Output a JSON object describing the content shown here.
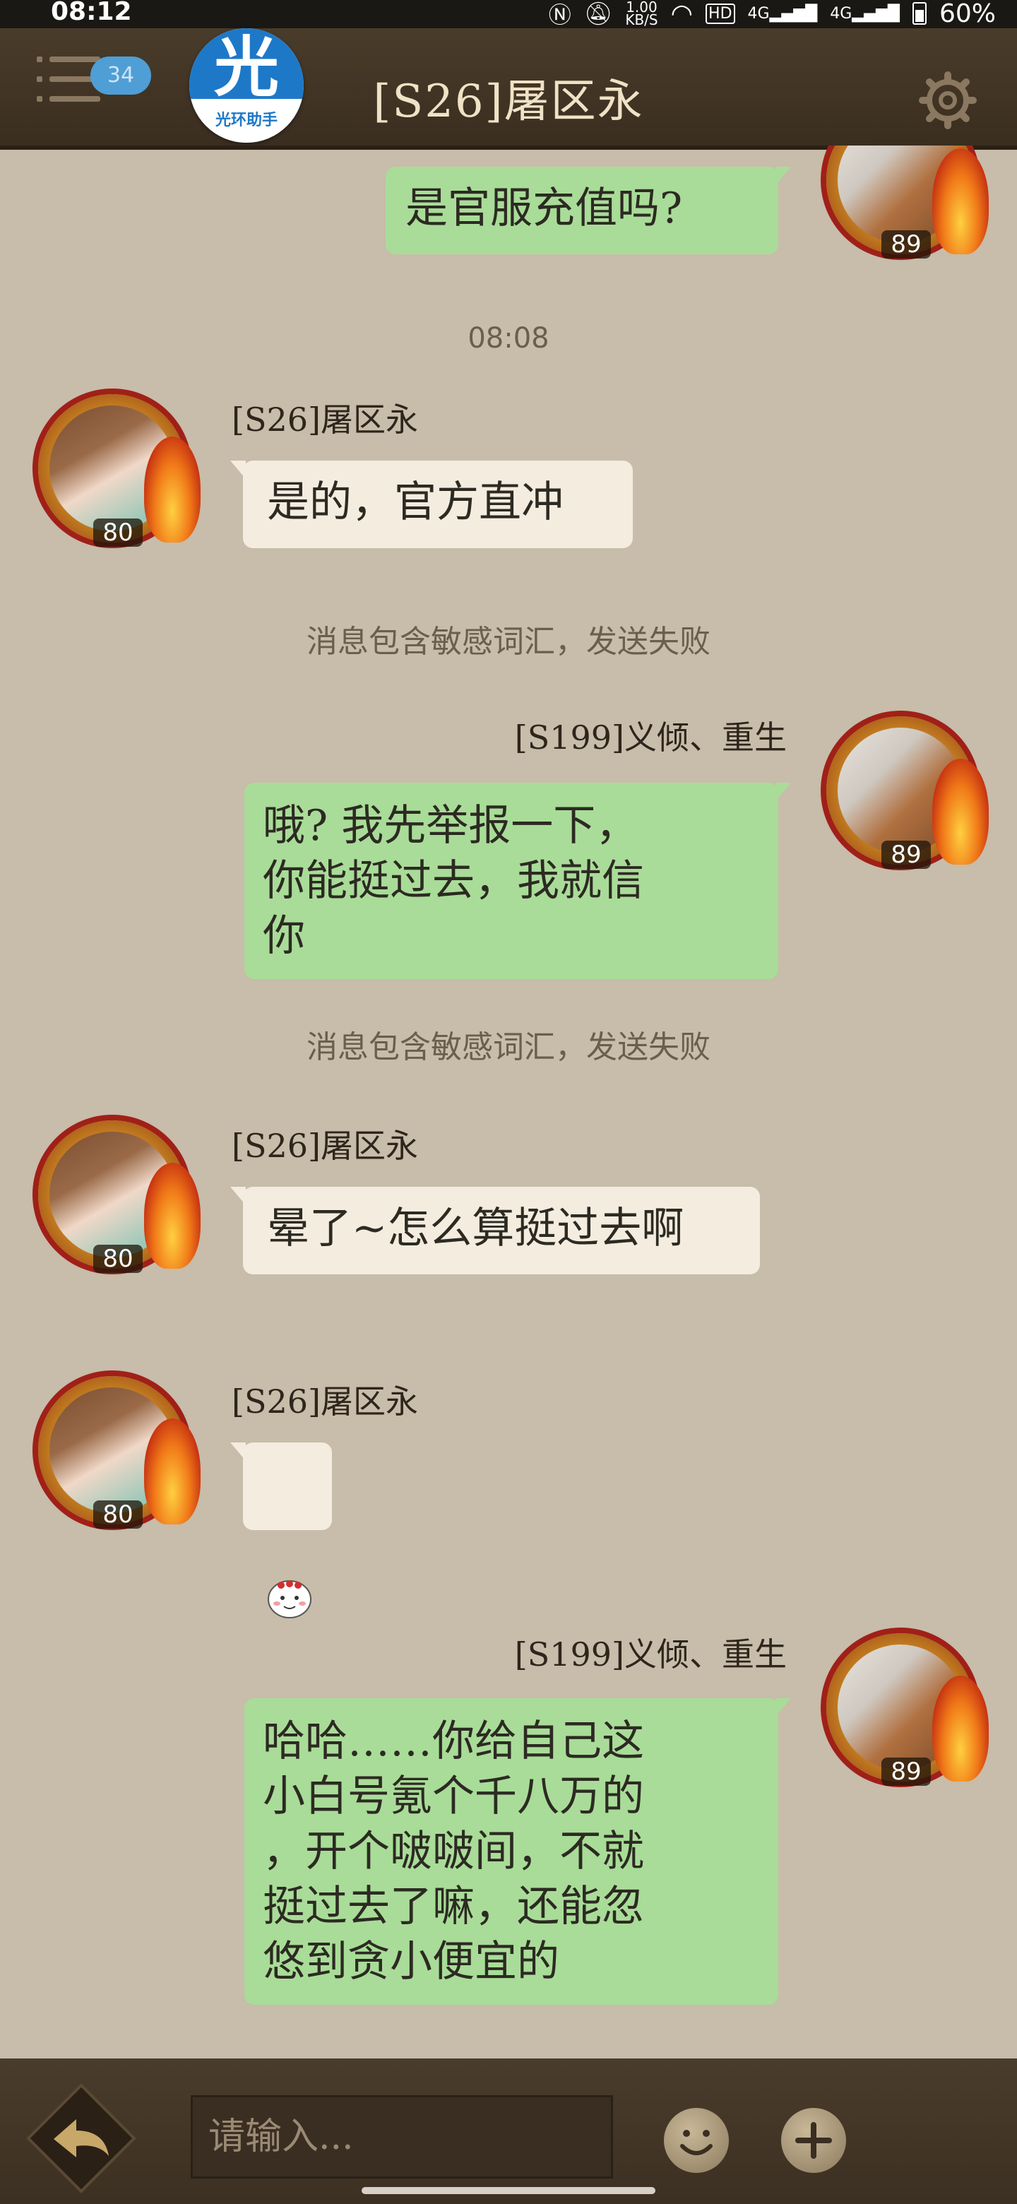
{
  "status_bar": {
    "time": "08:12",
    "net_speed_value": "1.00",
    "net_speed_unit": "KB/S",
    "hd_label": "HD",
    "signal_label_1": "4G",
    "signal_label_2": "4G",
    "battery": "60%"
  },
  "header": {
    "badge_count": "34",
    "logo_glyph": "光",
    "logo_text": "光环助手",
    "title": "[S26]屠区永"
  },
  "messages": [
    {
      "side": "right",
      "text": "是官服充值吗?",
      "level": "89"
    },
    {
      "type": "timestamp",
      "text": "08:08"
    },
    {
      "side": "left",
      "name": "[S26]屠区永",
      "text": "是的，官方直冲",
      "level": "80"
    },
    {
      "type": "system",
      "text": "消息包含敏感词汇，发送失败"
    },
    {
      "side": "right",
      "name": "[S199]义倾、重生",
      "text": "哦? 我先举报一下，\n你能挺过去，我就信\n你",
      "level": "89"
    },
    {
      "type": "system",
      "text": "消息包含敏感词汇，发送失败"
    },
    {
      "side": "left",
      "name": "[S26]屠区永",
      "text": "晕了~怎么算挺过去啊",
      "level": "80"
    },
    {
      "side": "left",
      "name": "[S26]屠区永",
      "sticker": "sticker-face",
      "level": "80"
    },
    {
      "side": "right",
      "name": "[S199]义倾、重生",
      "text": "哈哈……你给自己这\n小白号氪个千八万的\n，开个啵啵间，不就\n挺过去了嘛，还能忽\n悠到贪小便宜的",
      "level": "89"
    }
  ],
  "input_bar": {
    "placeholder": "请输入..."
  },
  "colors": {
    "background": "#c8bcaa",
    "header": "#3f3224",
    "bubble_self": "#a9dc98",
    "bubble_other": "#f3ecdf"
  }
}
